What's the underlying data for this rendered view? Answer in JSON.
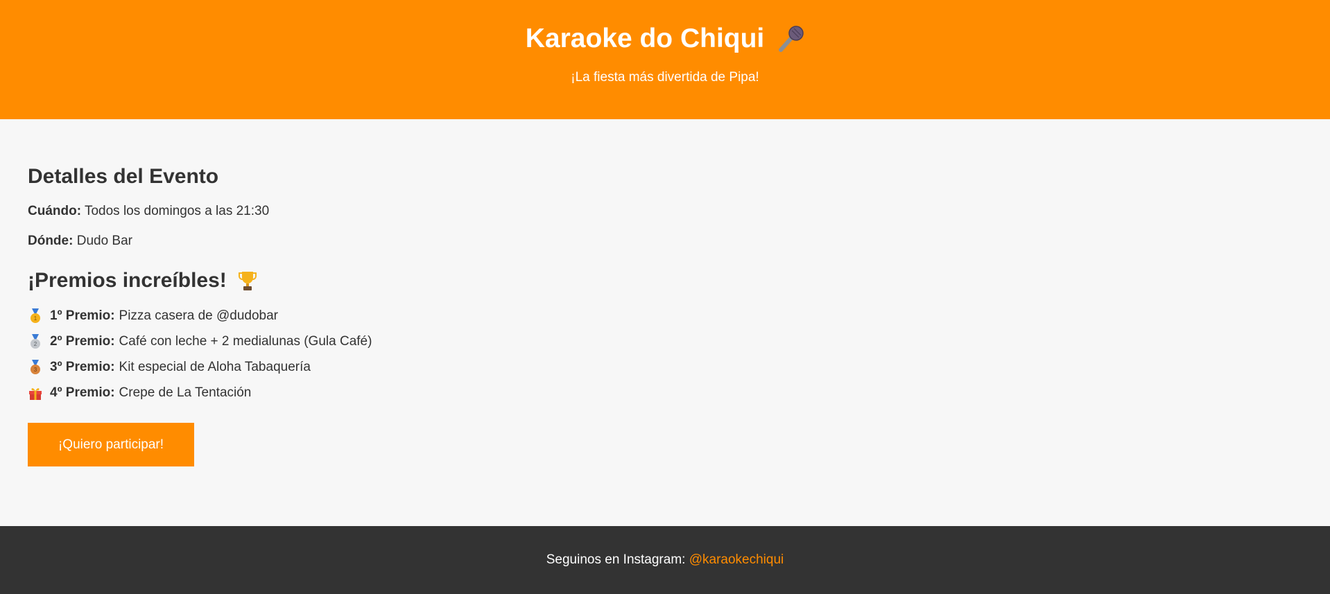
{
  "colors": {
    "accent": "#ff8c00",
    "footer_bg": "#333333",
    "page_bg": "#f7f7f7"
  },
  "header": {
    "title": "Karaoke do Chiqui",
    "title_icon": "microphone-icon",
    "subtitle": "¡La fiesta más divertida de Pipa!"
  },
  "details": {
    "heading": "Detalles del Evento",
    "when_label": "Cuándo:",
    "when_value": "Todos los domingos a las 21:30",
    "where_label": "Dónde:",
    "where_value": "Dudo Bar"
  },
  "prizes": {
    "heading": "¡Premios increíbles!",
    "heading_icon": "trophy-icon",
    "items": [
      {
        "icon": "gold-medal-icon",
        "label": "1º Premio:",
        "value": "Pizza casera de @dudobar"
      },
      {
        "icon": "silver-medal-icon",
        "label": "2º Premio:",
        "value": "Café con leche + 2 medialunas (Gula Café)"
      },
      {
        "icon": "bronze-medal-icon",
        "label": "3º Premio:",
        "value": "Kit especial de Aloha Tabaquería"
      },
      {
        "icon": "gift-icon",
        "label": "4º Premio:",
        "value": "Crepe de La Tentación"
      }
    ]
  },
  "cta": {
    "label": "¡Quiero participar!"
  },
  "footer": {
    "text": "Seguinos en Instagram:",
    "link": "@karaokechiqui"
  }
}
